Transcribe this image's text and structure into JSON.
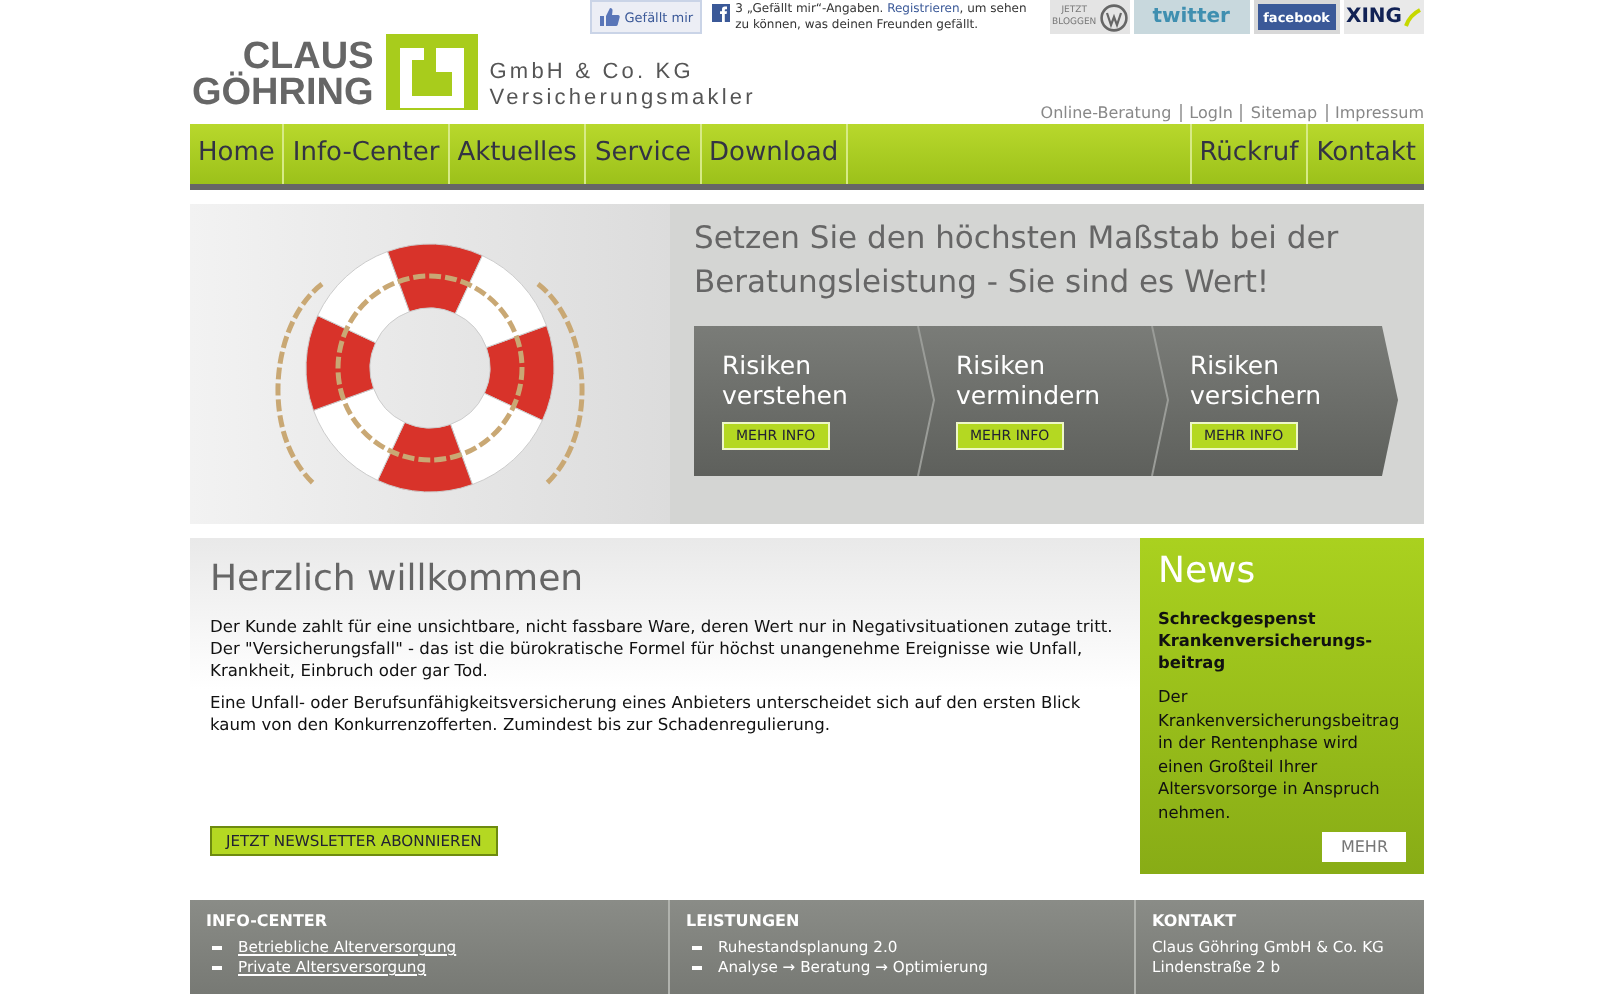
{
  "social": {
    "like_button": "Gefällt mir",
    "like_text_before": "3 „Gefällt mir“-Angaben.",
    "register_link": "Registrieren",
    "like_text_after": ", um sehen zu können, was deinen Freunden gefällt.",
    "badges": [
      {
        "kind": "blog",
        "label": "JETZT BLOGGEN"
      },
      {
        "kind": "twitter",
        "label": "twitter"
      },
      {
        "kind": "facebook",
        "label": "facebook"
      },
      {
        "kind": "xing",
        "label": "XING"
      }
    ]
  },
  "logo": {
    "name_lines": [
      "CLAUS",
      "GÖHRING"
    ],
    "company_lines": [
      "GmbH & Co. KG",
      "Versicherungsmakler"
    ]
  },
  "top_links": [
    "Online-Beratung",
    "LogIn",
    "Sitemap",
    "Impressum"
  ],
  "nav": {
    "left": [
      "Home",
      "Info-Center",
      "Aktuelles",
      "Service",
      "Download"
    ],
    "right": [
      "Rückruf",
      "Kontakt"
    ]
  },
  "hero": {
    "headline": "Setzen Sie den höchsten Maßstab bei der Beratungsleistung - Sie sind es Wert!",
    "steps": [
      {
        "title_lines": [
          "Risiken",
          "verstehen"
        ],
        "button": "MEHR INFO"
      },
      {
        "title_lines": [
          "Risiken",
          "vermindern"
        ],
        "button": "MEHR INFO"
      },
      {
        "title_lines": [
          "Risiken",
          "versichern"
        ],
        "button": "MEHR INFO"
      }
    ]
  },
  "welcome": {
    "title": "Herzlich willkommen",
    "paragraphs": [
      "Der Kunde zahlt für eine unsichtbare, nicht fassbare Ware, deren Wert nur in Negativsituationen zutage tritt. Der \"Versicherungsfall\" - das ist die bürokratische Formel für höchst unangenehme Ereignisse wie Unfall, Krankheit, Einbruch oder gar Tod.",
      "Eine Unfall- oder Berufsunfähigkeitsversicherung eines Anbieters unterscheidet sich auf den ersten Blick kaum von den Konkurrenzofferten. Zumindest bis zur Schadenregulierung."
    ],
    "newsletter_button": "JETZT NEWSLETTER ABONNIEREN"
  },
  "news": {
    "title": "News",
    "headline": "Schreckgespenst Krankenversicherungs-beitrag",
    "text": "Der Krankenversicherungsbeitrag in der Rentenphase wird einen Großteil Ihrer Altersvorsorge in Anspruch nehmen.",
    "button": "MEHR"
  },
  "footer": [
    {
      "title": "INFO-CENTER",
      "items": [
        {
          "kind": "link",
          "text": "Betriebliche Alterversorgung"
        },
        {
          "kind": "link",
          "text": "Private Altersversorgung"
        }
      ]
    },
    {
      "title": "LEISTUNGEN",
      "items": [
        {
          "kind": "bullet",
          "text": "Ruhestandsplanung 2.0"
        },
        {
          "kind": "bullet",
          "text": "Analyse → Beratung → Optimierung"
        }
      ]
    },
    {
      "title": "KONTAKT",
      "items": [
        {
          "kind": "plain",
          "text": "Claus Göhring GmbH & Co. KG"
        },
        {
          "kind": "plain",
          "text": "Lindenstraße 2 b"
        }
      ]
    }
  ]
}
